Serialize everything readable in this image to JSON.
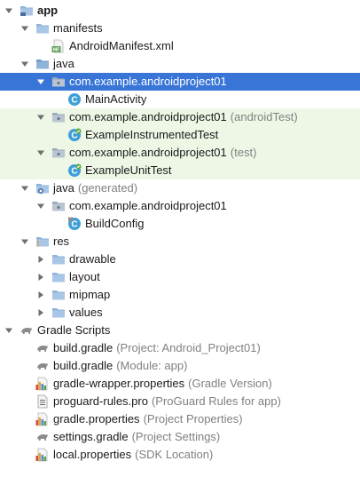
{
  "tree": {
    "rows": [
      {
        "label": "app",
        "secondary": "",
        "depth": 0,
        "arrow": "down",
        "icon": "module-folder-icon",
        "bold": true,
        "state": ""
      },
      {
        "label": "manifests",
        "secondary": "",
        "depth": 1,
        "arrow": "down",
        "icon": "folder-icon",
        "state": ""
      },
      {
        "label": "AndroidManifest.xml",
        "secondary": "",
        "depth": 2,
        "arrow": "none",
        "icon": "manifest-file-icon",
        "state": ""
      },
      {
        "label": "java",
        "secondary": "",
        "depth": 1,
        "arrow": "down",
        "icon": "source-folder-icon",
        "state": ""
      },
      {
        "label": "com.example.androidproject01",
        "secondary": "",
        "depth": 2,
        "arrow": "down",
        "icon": "package-icon",
        "state": "selected"
      },
      {
        "label": "MainActivity",
        "secondary": "",
        "depth": 3,
        "arrow": "none",
        "icon": "class-icon",
        "state": ""
      },
      {
        "label": "com.example.androidproject01",
        "secondary": "(androidTest)",
        "depth": 2,
        "arrow": "down",
        "icon": "package-icon",
        "state": "tinted"
      },
      {
        "label": "ExampleInstrumentedTest",
        "secondary": "",
        "depth": 3,
        "arrow": "none",
        "icon": "test-class-icon",
        "state": "tinted"
      },
      {
        "label": "com.example.androidproject01",
        "secondary": "(test)",
        "depth": 2,
        "arrow": "down",
        "icon": "package-icon",
        "state": "tinted"
      },
      {
        "label": "ExampleUnitTest",
        "secondary": "",
        "depth": 3,
        "arrow": "none",
        "icon": "test-class-icon",
        "state": "tinted"
      },
      {
        "label": "java",
        "secondary": "(generated)",
        "depth": 1,
        "arrow": "down",
        "icon": "generated-source-folder-icon",
        "state": ""
      },
      {
        "label": "com.example.androidproject01",
        "secondary": "",
        "depth": 2,
        "arrow": "down",
        "icon": "package-icon",
        "state": ""
      },
      {
        "label": "BuildConfig",
        "secondary": "",
        "depth": 3,
        "arrow": "none",
        "icon": "locked-class-icon",
        "state": ""
      },
      {
        "label": "res",
        "secondary": "",
        "depth": 1,
        "arrow": "down",
        "icon": "resource-folder-icon",
        "state": ""
      },
      {
        "label": "drawable",
        "secondary": "",
        "depth": 2,
        "arrow": "right",
        "icon": "folder-icon",
        "state": ""
      },
      {
        "label": "layout",
        "secondary": "",
        "depth": 2,
        "arrow": "right",
        "icon": "folder-icon",
        "state": ""
      },
      {
        "label": "mipmap",
        "secondary": "",
        "depth": 2,
        "arrow": "right",
        "icon": "folder-icon",
        "state": ""
      },
      {
        "label": "values",
        "secondary": "",
        "depth": 2,
        "arrow": "right",
        "icon": "folder-icon",
        "state": ""
      },
      {
        "label": "Gradle Scripts",
        "secondary": "",
        "depth": 0,
        "arrow": "down",
        "icon": "gradle-icon",
        "state": ""
      },
      {
        "label": "build.gradle",
        "secondary": "(Project: Android_Project01)",
        "depth": 1,
        "arrow": "none",
        "icon": "gradle-icon",
        "state": ""
      },
      {
        "label": "build.gradle",
        "secondary": "(Module: app)",
        "depth": 1,
        "arrow": "none",
        "icon": "gradle-icon",
        "state": ""
      },
      {
        "label": "gradle-wrapper.properties",
        "secondary": "(Gradle Version)",
        "depth": 1,
        "arrow": "none",
        "icon": "properties-file-icon",
        "state": ""
      },
      {
        "label": "proguard-rules.pro",
        "secondary": "(ProGuard Rules for app)",
        "depth": 1,
        "arrow": "none",
        "icon": "text-file-icon",
        "state": ""
      },
      {
        "label": "gradle.properties",
        "secondary": "(Project Properties)",
        "depth": 1,
        "arrow": "none",
        "icon": "properties-file-icon",
        "state": ""
      },
      {
        "label": "settings.gradle",
        "secondary": "(Project Settings)",
        "depth": 1,
        "arrow": "none",
        "icon": "gradle-icon",
        "state": ""
      },
      {
        "label": "local.properties",
        "secondary": "(SDK Location)",
        "depth": 1,
        "arrow": "none",
        "icon": "properties-file-icon",
        "state": ""
      }
    ]
  },
  "colors": {
    "selection": "#3875d7",
    "test_tint": "#eef7e6",
    "secondary_text": "#808080",
    "folder": "#8fb3d9",
    "class": "#3f9fd6",
    "manifest": "#63a35c"
  }
}
